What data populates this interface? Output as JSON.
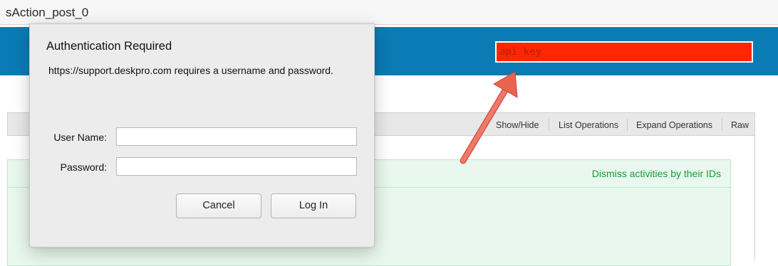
{
  "browser": {
    "tab_title": "sAction_post_0"
  },
  "header": {
    "api_key_placeholder": "api_key"
  },
  "operations": {
    "links": [
      "Show/Hide",
      "List Operations",
      "Expand Operations",
      "Raw"
    ]
  },
  "resource": {
    "description": "Dismiss activities by their IDs"
  },
  "auth_dialog": {
    "title": "Authentication Required",
    "message": "https://support.deskpro.com requires a username and password.",
    "username_label": "User Name:",
    "password_label": "Password:",
    "username_value": "",
    "password_value": "",
    "cancel_label": "Cancel",
    "login_label": "Log In"
  },
  "colors": {
    "header_blue": "#0a7bb5",
    "api_key_highlight": "#ff2600",
    "arrow": "#e9634f",
    "success_green": "#119c3a"
  },
  "icons": {
    "annotation": "arrow-icon"
  }
}
